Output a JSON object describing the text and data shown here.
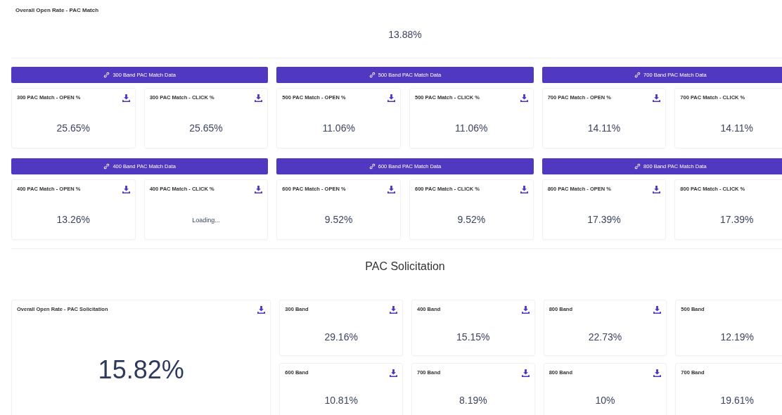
{
  "overall": {
    "title": "Overall Open Rate - PAC Match",
    "value": "13.88%"
  },
  "bands": [
    {
      "title": "300 Band PAC Match Data",
      "cards": [
        {
          "title": "300 PAC Match - OPEN %",
          "value": "25.65%",
          "download": true
        },
        {
          "title": "300 PAC Match - CLICK %",
          "value": "25.65%",
          "download": true
        }
      ]
    },
    {
      "title": "500 Band PAC Match Data",
      "cards": [
        {
          "title": "500 PAC Match - OPEN %",
          "value": "11.06%",
          "download": true
        },
        {
          "title": "500 PAC Match - CLICK %",
          "value": "11.06%",
          "download": true
        }
      ]
    },
    {
      "title": "700 Band PAC Match Data",
      "cards": [
        {
          "title": "700 PAC Match - OPEN %",
          "value": "14.11%",
          "download": true
        },
        {
          "title": "700 PAC Match - CLICK %",
          "value": "14.11%"
        }
      ]
    },
    {
      "title": "400 Band PAC Match Data",
      "cards": [
        {
          "title": "400 PAC Match - OPEN %",
          "value": "13.26%",
          "download": true
        },
        {
          "title": "400 PAC Match - CLICK %",
          "value": "Loading...",
          "download": true
        }
      ]
    },
    {
      "title": "600 Band PAC Match Data",
      "cards": [
        {
          "title": "600 PAC Match - OPEN %",
          "value": "9.52%",
          "download": true
        },
        {
          "title": "600 PAC Match - CLICK %",
          "value": "9.52%",
          "download": true
        }
      ]
    },
    {
      "title": "800 Band PAC Match Data",
      "cards": [
        {
          "title": "800 PAC Match - OPEN %",
          "value": "17.39%",
          "download": true
        },
        {
          "title": "800 PAC Match - CLICK %",
          "value": "17.39%"
        }
      ]
    }
  ],
  "solicitation": {
    "heading": "PAC Solicitation",
    "overall": {
      "title": "Overall Open Rate - PAC Solicitation",
      "value": "15.82%",
      "download": true
    },
    "bands": [
      {
        "title": "300 Band",
        "value": "29.16%",
        "download": true
      },
      {
        "title": "400 Band",
        "value": "15.15%",
        "download": true
      },
      {
        "title": "800 Band",
        "value": "22.73%",
        "download": true
      },
      {
        "title": "500 Band",
        "value": "12.19%"
      },
      {
        "title": "600 Band",
        "value": "10.81%",
        "download": true
      },
      {
        "title": "700 Band",
        "value": "8.19%",
        "download": true
      },
      {
        "title": "800 Band",
        "value": "10%",
        "download": true
      },
      {
        "title": "700 Band",
        "value": "19.61%"
      }
    ]
  }
}
